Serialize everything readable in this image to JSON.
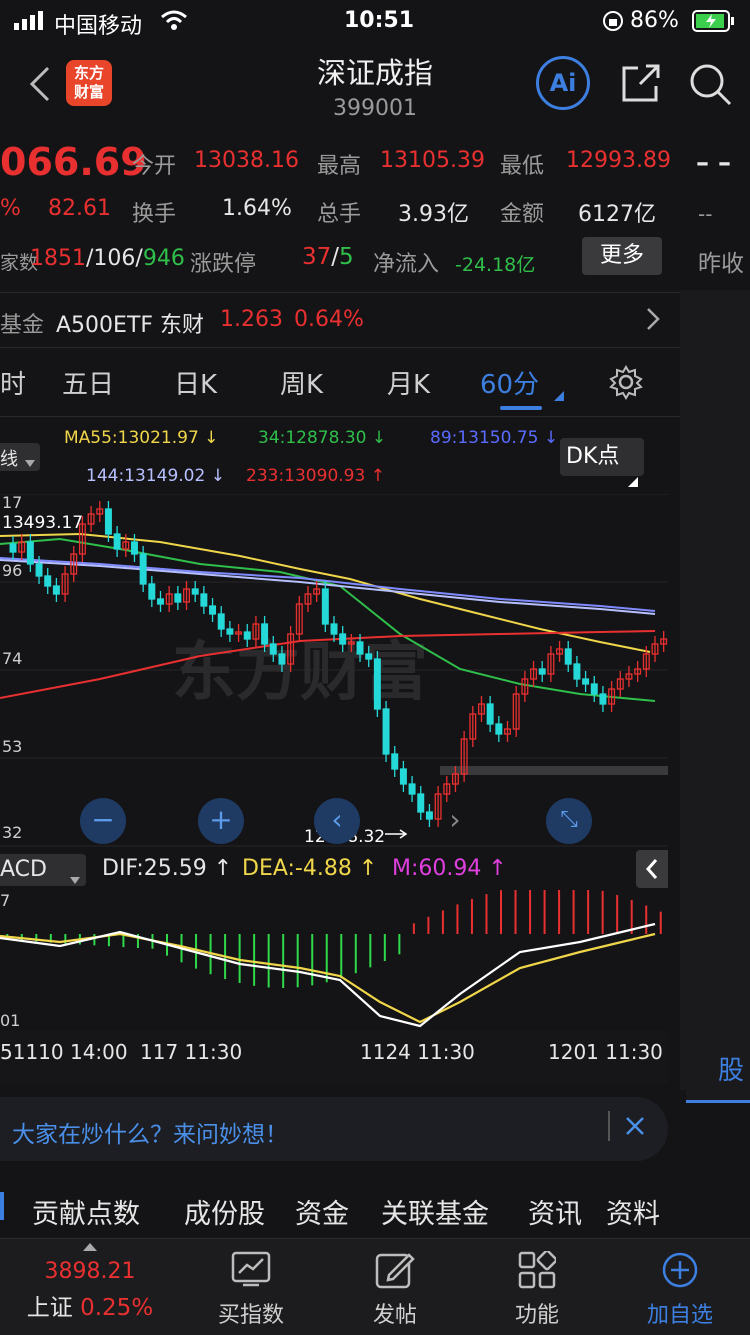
{
  "status_bar": {
    "carrier": "中国移动",
    "time": "10:51",
    "battery": "86%"
  },
  "header": {
    "title": "深证成指",
    "code": "399001",
    "logo_line1": "东方",
    "logo_line2": "财富",
    "ai_label": "Ai"
  },
  "quote": {
    "price": "066.69",
    "change": "82.61",
    "change_pct_partial": "%",
    "open_label": "今开",
    "open": "13038.16",
    "high_label": "最高",
    "high": "13105.39",
    "low_label": "最低",
    "low": "12993.89",
    "turnover_label": "换手",
    "turnover": "1.64%",
    "volume_label": "总手",
    "volume": "3.93亿",
    "amount_label": "金额",
    "amount": "6127亿",
    "breadth_label": "家数",
    "up": "1851",
    "flat": "106",
    "down": "946",
    "limit_label": "涨跌停",
    "limit_up": "37",
    "limit_down": "5",
    "inflow_label": "净流入",
    "inflow": "-24.18亿",
    "more_label": "更多",
    "side_dash1": "– –",
    "side_dash2": "--",
    "side_label": "昨收"
  },
  "fund_bar": {
    "prefix": "基金",
    "name": "A500ETF 东财",
    "price": "1.263",
    "pct": "0.64%"
  },
  "tabs": {
    "t0": "时",
    "t1": "五日",
    "t2": "日K",
    "t3": "周K",
    "t4": "月K",
    "t5": "60分"
  },
  "ma_legend": {
    "ma55": "MA55:13021.97 ↓",
    "ma34": "34:12878.30 ↓",
    "ma89": "89:13150.75 ↓",
    "ma144": "144:13149.02 ↓",
    "ma233": "233:13090.93 ↑",
    "selector": "线",
    "dk": "DK点"
  },
  "chart_data": {
    "type": "candlestick",
    "y_ticks": [
      "17",
      "13493.17",
      "96",
      "74",
      "53",
      "32"
    ],
    "max_label": "13493.17",
    "min_label": "12448.32",
    "watermark": "东方财富"
  },
  "macd": {
    "name": "ACD",
    "dif": "DIF:25.59 ↑",
    "dea": "DEA:-4.88 ↑",
    "m": "M:60.94 ↑",
    "top_tick": "7",
    "bottom_tick": "01"
  },
  "x_axis": {
    "l1": "51110 14:00",
    "l2": "117 11:30",
    "l3": "1124 11:30",
    "l4": "1201 11:30"
  },
  "ai_bar": {
    "text": "大家在炒什么？来问妙想！"
  },
  "bottom_tabs": {
    "b1": "贡献点数",
    "b2": "成份股",
    "b3": "资金",
    "b4": "关联基金",
    "b5": "资讯",
    "b6": "资料"
  },
  "side_tab": {
    "label": "股"
  },
  "nav": {
    "index_price": "3898.21",
    "index_name": "上证",
    "index_pct": "0.25%",
    "n1": "买指数",
    "n2": "发帖",
    "n3": "功能",
    "n4": "加自选"
  }
}
